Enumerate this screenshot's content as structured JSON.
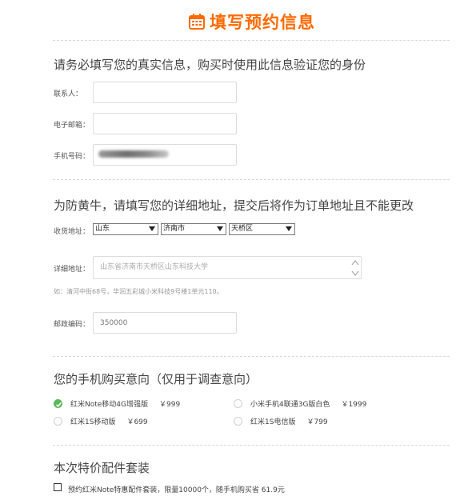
{
  "page_title": "填写预约信息",
  "contact_section": {
    "heading": "请务必填写您的真实信息，购买时使用此信息验证您的身份",
    "fields": [
      {
        "label": "联系人：",
        "value": "",
        "placeholder": ""
      },
      {
        "label": "电子邮箱：",
        "value": "",
        "placeholder": ""
      },
      {
        "label": "手机号码：",
        "value": "",
        "placeholder": ""
      }
    ]
  },
  "address_section": {
    "heading": "为防黄牛，请填写您的详细地址，提交后将作为订单地址且不能更改",
    "region_label": "收货地址：",
    "province": "山东",
    "city": "济南市",
    "district": "天桥区",
    "detail_label": "详细地址：",
    "detail_placeholder": "山东省济南市天桥区山东科技大学",
    "detail_hint": "如：清河中街68号，华润五彩城小米科技9号楼1单元110。",
    "zip_label": "邮政编码：",
    "zip_placeholder": "350000"
  },
  "intent_section": {
    "heading": "您的手机购买意向（仅用于调查意向）",
    "options": [
      {
        "name": "红米Note移动4G增强版",
        "price": "￥999",
        "checked": true
      },
      {
        "name": "小米手机4联通3G版白色",
        "price": "￥1999",
        "checked": false
      },
      {
        "name": "红米1S移动版",
        "price": "￥699",
        "checked": false
      },
      {
        "name": "红米1S电信版",
        "price": "￥799",
        "checked": false
      }
    ]
  },
  "accessory_section": {
    "heading": "本次特价配件套装",
    "item_text": "预约红米Note特惠配件套装，限量10000个，随手机购买省 61.9元",
    "checked": false
  },
  "colors": {
    "accent": "#ff6a00",
    "check_green": "#5cb85c"
  },
  "icons": {
    "title": "calendar-icon",
    "selected": "check-icon"
  }
}
